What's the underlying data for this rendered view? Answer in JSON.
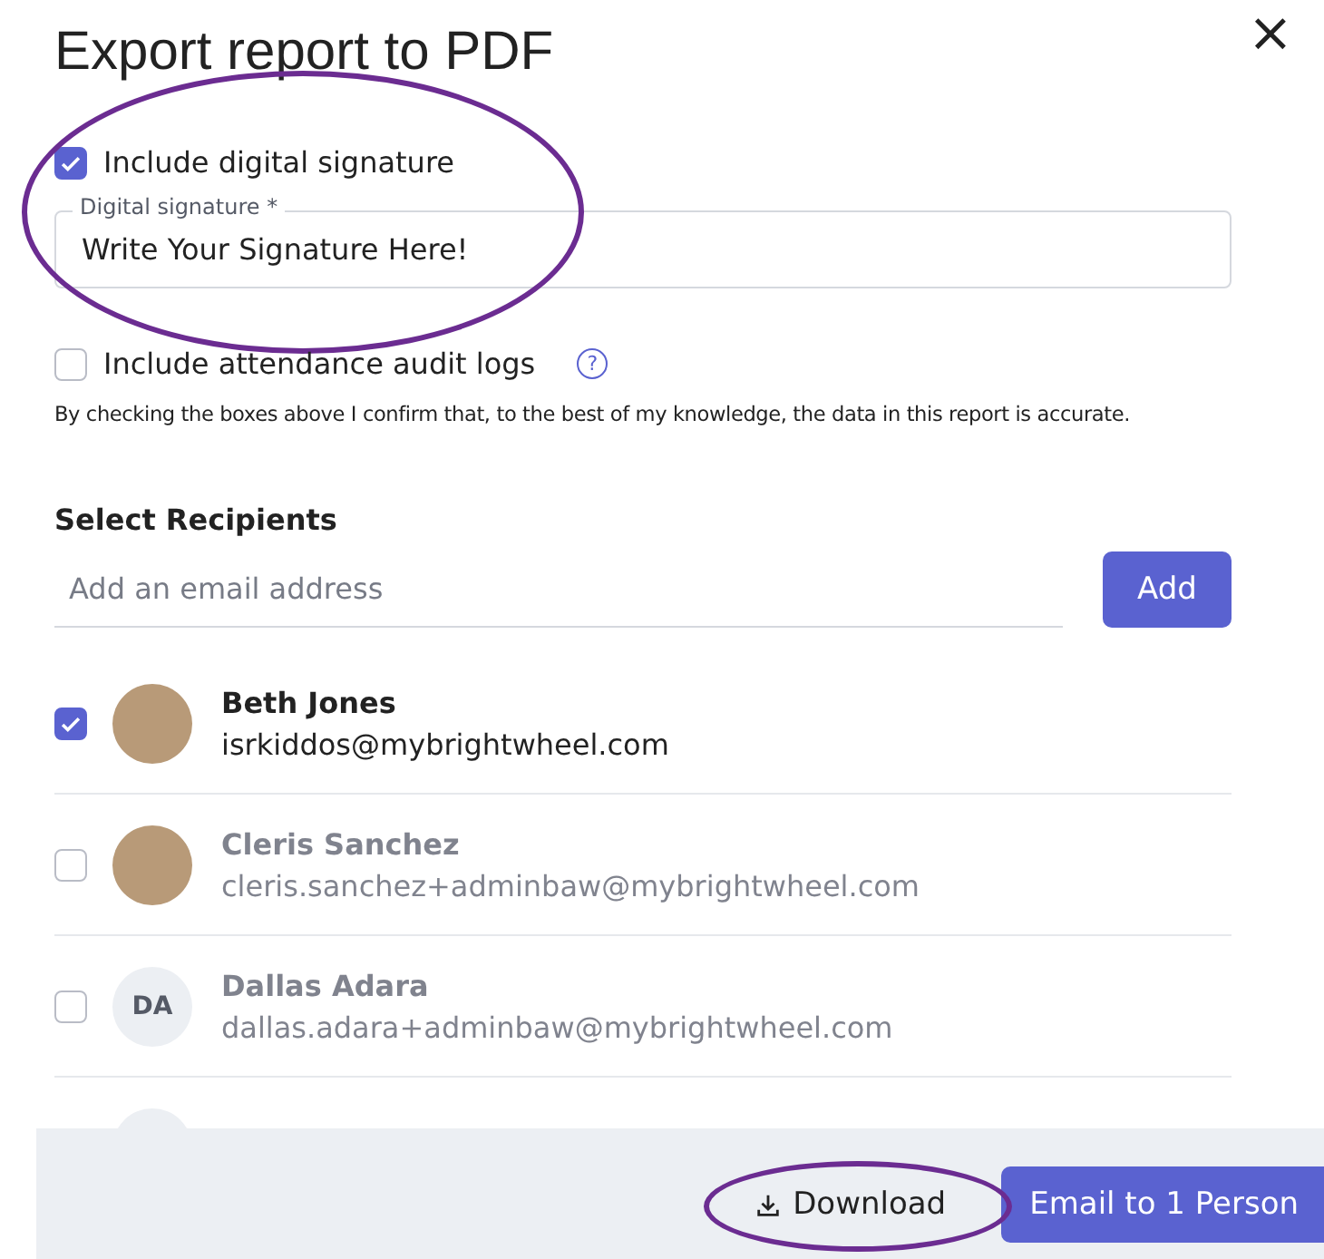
{
  "dialog": {
    "title": "Export report to PDF",
    "close": "×"
  },
  "options": [
    {
      "kind": "signature",
      "label": "Include digital signature",
      "checked": true,
      "circled": true,
      "field": {
        "label": "Digital signature *",
        "value": "Write Your Signature Here!"
      }
    },
    {
      "kind": "help",
      "label": "Include attendance audit logs",
      "checked": false,
      "help": "?"
    }
  ],
  "notice": "By checking the boxes above I confirm that, to the best of my knowledge, the data in this report is accurate.",
  "recipients": {
    "heading": "Select Recipients",
    "email_placeholder": "Add an email address",
    "add_button": "Add",
    "people": [
      {
        "photo": true,
        "name": "Beth Jones",
        "email": "isrkiddos@mybrightwheel.com",
        "checked": true
      },
      {
        "photo": true,
        "name": "Cleris Sanchez",
        "email": "cleris.sanchez+adminbaw@mybrightwheel.com",
        "checked": false
      },
      {
        "photo": false,
        "initials": "DA",
        "name": "Dallas Adara",
        "email": "dallas.adara+adminbaw@mybrightwheel.com",
        "checked": false
      },
      {
        "photo": false
      }
    ]
  },
  "footer": {
    "download": {
      "label": "Download",
      "circled": true
    },
    "email_button": "Email to 1 Person"
  }
}
